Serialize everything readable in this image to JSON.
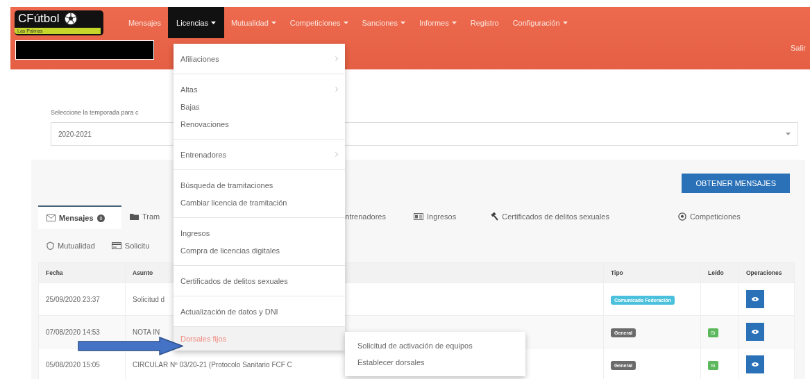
{
  "navbar": {
    "logo": {
      "title": "CFútbol",
      "subtitle": "Las Palmas"
    },
    "items": [
      {
        "label": "Mensajes",
        "dropdown": false,
        "selected": false
      },
      {
        "label": "Licencias",
        "dropdown": true,
        "selected": true
      },
      {
        "label": "Mutualidad",
        "dropdown": true,
        "selected": false
      },
      {
        "label": "Competiciones",
        "dropdown": true,
        "selected": false
      },
      {
        "label": "Sanciones",
        "dropdown": true,
        "selected": false
      },
      {
        "label": "Informes",
        "dropdown": true,
        "selected": false
      },
      {
        "label": "Registro",
        "dropdown": false,
        "selected": false
      },
      {
        "label": "Configuración",
        "dropdown": true,
        "selected": false
      }
    ],
    "logout": "Salir"
  },
  "season": {
    "label": "Seleccione la temporada para c",
    "value": "2020-2021"
  },
  "fetch_button": "OBTENER MENSAJES",
  "tabs": [
    {
      "label": "Mensajes",
      "badge": "0",
      "selected": true
    },
    {
      "label": "Tram",
      "selected": false
    },
    {
      "label": "ntrenadores",
      "selected": false
    },
    {
      "label": "Ingresos",
      "selected": false
    },
    {
      "label": "Certificados de delitos sexuales",
      "selected": false
    },
    {
      "label": "Competiciones",
      "selected": false
    },
    {
      "label": "Mutualidad",
      "selected": false
    },
    {
      "label": "Solicitu",
      "selected": false
    }
  ],
  "table": {
    "columns": [
      "Fecha",
      "Asunto",
      "Tipo",
      "Leído",
      "Operaciones"
    ],
    "rows": [
      {
        "date": "25/09/2020 23:37",
        "subject": "Solicitud d",
        "type": {
          "label": "Comunicado Federación",
          "kind": "federation"
        },
        "read": false
      },
      {
        "date": "07/08/2020 14:53",
        "subject": "NOTA IN",
        "type": {
          "label": "General",
          "kind": "general"
        },
        "read": true,
        "read_label": "Sí"
      },
      {
        "date": "05/08/2020 15:05",
        "subject": "CIRCULAR Nº 03/20-21 (Protocolo Sanitario FCF C",
        "type": {
          "label": "General",
          "kind": "general"
        },
        "read": true,
        "read_label": "Sí"
      }
    ]
  },
  "menu": {
    "groups": [
      [
        {
          "label": "Afiliaciones",
          "submenu": true,
          "selected": false
        }
      ],
      [
        {
          "label": "Altas",
          "submenu": true,
          "selected": false
        },
        {
          "label": "Bajas",
          "submenu": false,
          "selected": false
        },
        {
          "label": "Renovaciones",
          "submenu": false,
          "selected": false
        }
      ],
      [
        {
          "label": "Entrenadores",
          "submenu": true,
          "selected": false
        }
      ],
      [
        {
          "label": "Búsqueda de tramitaciones",
          "submenu": false,
          "selected": false
        },
        {
          "label": "Cambiar licencia de tramitación",
          "submenu": false,
          "selected": false
        }
      ],
      [
        {
          "label": "Ingresos",
          "submenu": false,
          "selected": false
        },
        {
          "label": "Compra de licencias digitales",
          "submenu": false,
          "selected": false
        }
      ],
      [
        {
          "label": "Certificados de delitos sexuales",
          "submenu": false,
          "selected": false
        }
      ],
      [
        {
          "label": "Actualización de datos y DNI",
          "submenu": false,
          "selected": false
        }
      ],
      [
        {
          "label": "Dorsales fijos",
          "submenu": false,
          "selected": true
        }
      ]
    ],
    "submenu": [
      "Solicitud de activación de equipos",
      "Establecer dorsales"
    ]
  }
}
